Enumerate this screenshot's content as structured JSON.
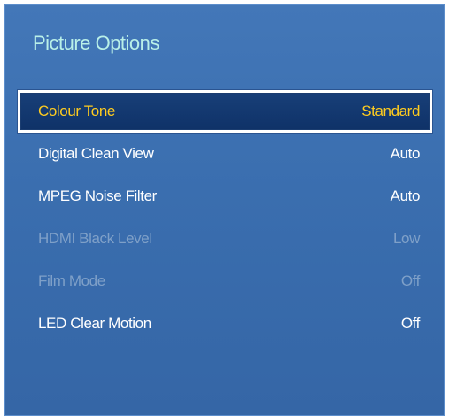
{
  "panel": {
    "title": "Picture Options",
    "items": [
      {
        "label": "Colour Tone",
        "value": "Standard",
        "state": "selected"
      },
      {
        "label": "Digital Clean View",
        "value": "Auto",
        "state": "enabled"
      },
      {
        "label": "MPEG Noise Filter",
        "value": "Auto",
        "state": "enabled"
      },
      {
        "label": "HDMI Black Level",
        "value": "Low",
        "state": "disabled"
      },
      {
        "label": "Film Mode",
        "value": "Off",
        "state": "disabled"
      },
      {
        "label": "LED Clear Motion",
        "value": "Off",
        "state": "enabled"
      }
    ]
  },
  "colors": {
    "panel_background": "#3a6eaf",
    "title_text": "#b9f0e8",
    "selected_text": "#ffcc1f",
    "selected_background": "#133a72",
    "normal_text": "#ffffff",
    "disabled_text": "#7fa0c8"
  }
}
